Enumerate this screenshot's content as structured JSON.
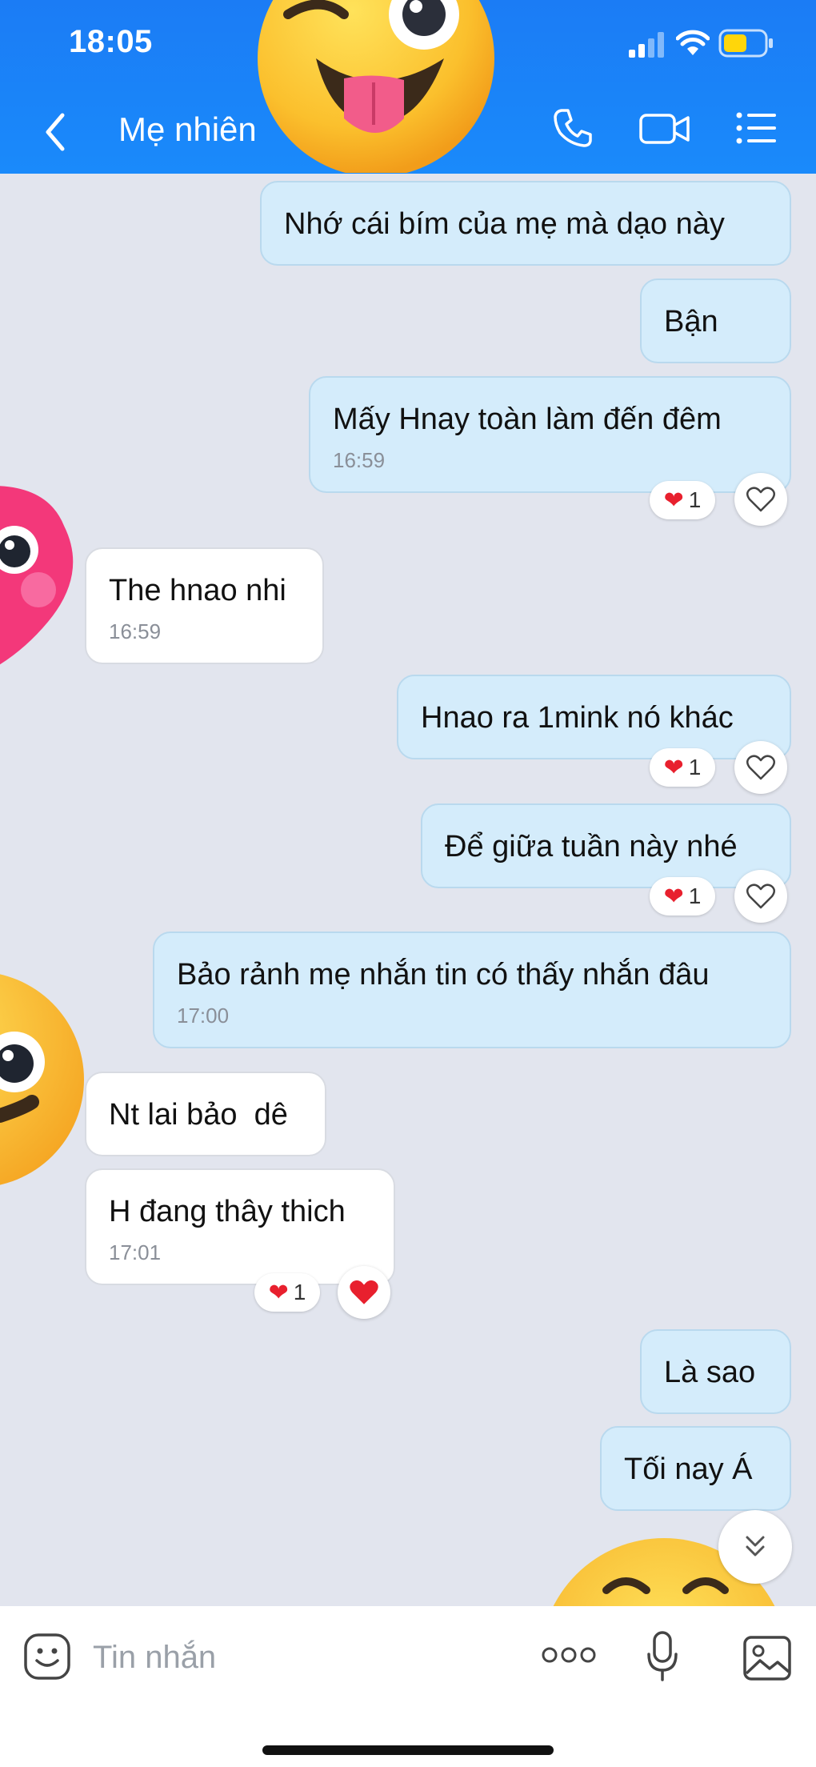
{
  "status": {
    "time": "18:05"
  },
  "header": {
    "contact_name": "Mẹ nhiên"
  },
  "messages": [
    {
      "text": "Nhớ cái bím của mẹ mà dạo này"
    },
    {
      "text": "Bận"
    },
    {
      "text": "Mấy Hnay toàn làm đến đêm",
      "time": "16:59",
      "reaction_count": "1"
    },
    {
      "text": "The hnao nhi",
      "time": "16:59"
    },
    {
      "text": "Hnao ra 1mink nó khác",
      "reaction_count": "1"
    },
    {
      "text": "Để giữa tuần này nhé",
      "reaction_count": "1"
    },
    {
      "text": "Bảo rảnh mẹ nhắn tin có thấy nhắn đâu",
      "time": "17:00"
    },
    {
      "text": "Nt lai bảo  dê"
    },
    {
      "text": "H đang thây thich",
      "time": "17:01",
      "reaction_count": "1"
    },
    {
      "text": "Là sao"
    },
    {
      "text": "Tối nay Á"
    }
  ],
  "input": {
    "placeholder": "Tin nhắn"
  },
  "colors": {
    "header": "#1a84f8",
    "chat_background": "#e2e5ee",
    "outgoing_bubble": "#d4ecfb",
    "incoming_bubble": "#ffffff",
    "reaction_heart": "#e8202e"
  },
  "icons": [
    "back-icon",
    "phone-icon",
    "video-icon",
    "list-menu-icon",
    "heart-icon",
    "chevron-double-down-icon",
    "sticker-icon",
    "more-icon",
    "microphone-icon",
    "gallery-icon"
  ]
}
